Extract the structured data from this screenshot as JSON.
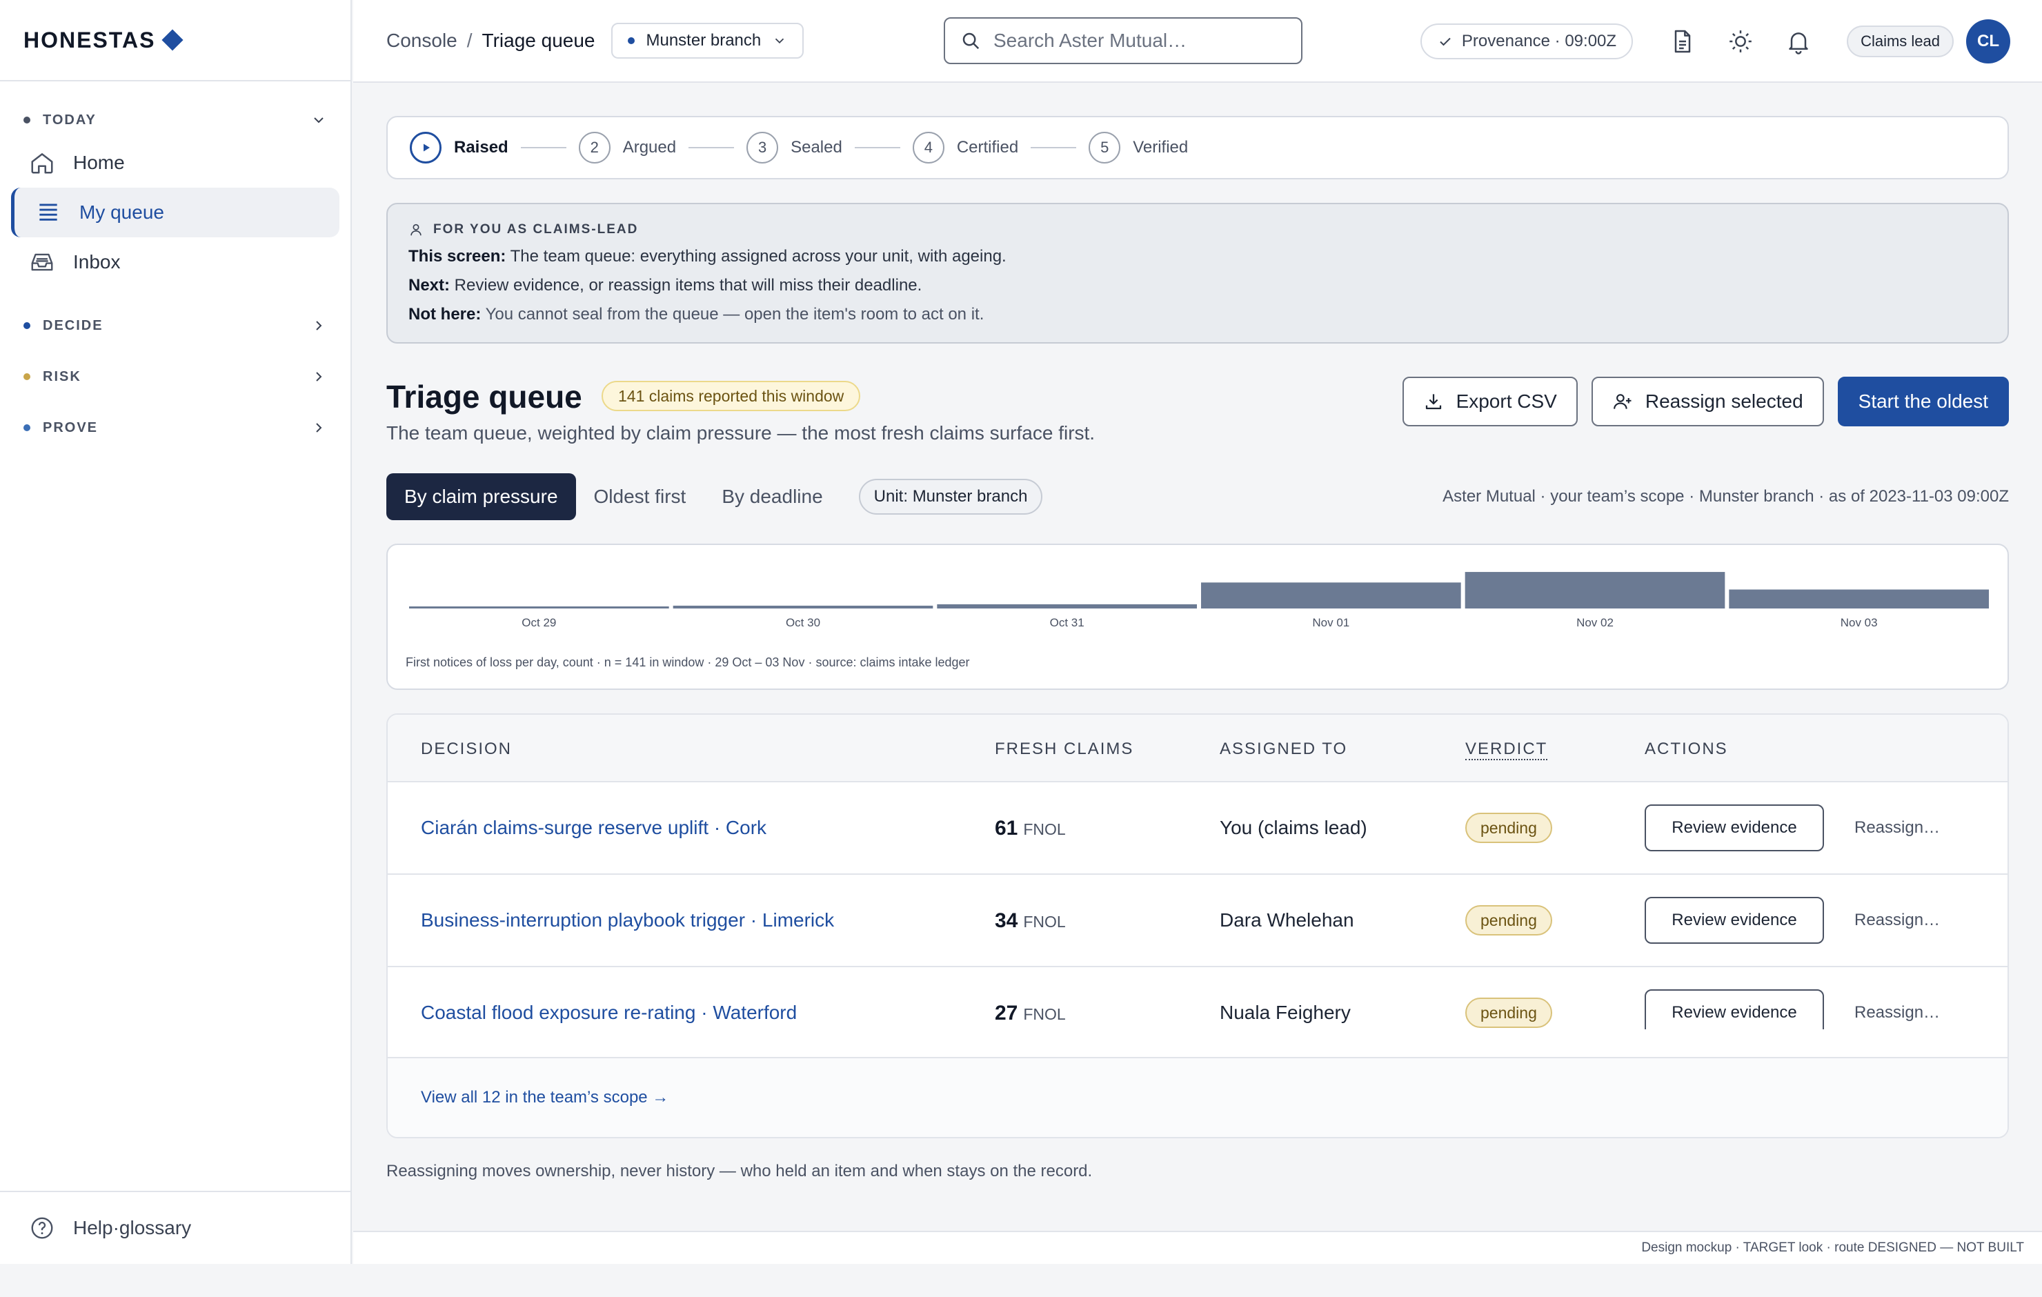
{
  "brand": {
    "name": "HONESTAS"
  },
  "sidebar": {
    "sections": [
      {
        "label": "TODAY",
        "dot_color": "#4a5263",
        "expanded": true
      },
      {
        "label": "DECIDE",
        "dot_color": "#1f4ea0",
        "expanded": false
      },
      {
        "label": "RISK",
        "dot_color": "#c9a54a",
        "expanded": false
      },
      {
        "label": "PROVE",
        "dot_color": "#3b6fb6",
        "expanded": false
      }
    ],
    "items": [
      {
        "label": "Home",
        "icon": "home-icon"
      },
      {
        "label": "My queue",
        "icon": "queue-icon",
        "active": true
      },
      {
        "label": "Inbox",
        "icon": "inbox-icon"
      }
    ],
    "footer": {
      "label": "Help·glossary",
      "icon": "help-icon"
    }
  },
  "topbar": {
    "breadcrumb": {
      "root": "Console",
      "separator": "/",
      "current": "Triage queue"
    },
    "branch": "Munster branch",
    "search_placeholder": "Search Aster Mutual…",
    "provenance": "Provenance · 09:00Z",
    "role": "Claims lead",
    "avatar": "CL"
  },
  "stepper": {
    "steps": [
      {
        "marker": "",
        "label": "Raised",
        "active": true
      },
      {
        "marker": "2",
        "label": "Argued"
      },
      {
        "marker": "3",
        "label": "Sealed"
      },
      {
        "marker": "4",
        "label": "Certified"
      },
      {
        "marker": "5",
        "label": "Verified"
      }
    ]
  },
  "info": {
    "heading": "FOR YOU AS CLAIMS-LEAD",
    "lines": [
      {
        "key": "This screen:",
        "text": " The team queue: everything assigned across your unit, with ageing."
      },
      {
        "key": "Next:",
        "text": " Review evidence, or reassign items that will miss their deadline."
      },
      {
        "key": "Not here:",
        "text": " You cannot seal from the queue — open the item's room to act on it."
      }
    ]
  },
  "page": {
    "title": "Triage queue",
    "badge": "141 claims reported this window",
    "subtitle": "The team queue, weighted by claim pressure — the most fresh claims surface first.",
    "buttons": {
      "export": "Export CSV",
      "reassign": "Reassign selected",
      "start": "Start the oldest"
    }
  },
  "filters": {
    "options": [
      "By claim pressure",
      "Oldest first",
      "By deadline"
    ],
    "active_index": 0,
    "unit_chip": "Unit: Munster branch",
    "scope_note": "Aster Mutual · your team’s scope · Munster branch · as of 2023-11-03 09:00Z"
  },
  "chart_data": {
    "type": "bar",
    "categories": [
      "Oct 29",
      "Oct 30",
      "Oct 31",
      "Nov 01",
      "Nov 02",
      "Nov 03"
    ],
    "values": [
      2,
      4,
      6,
      37,
      52,
      27
    ],
    "ylim": [
      0,
      55
    ],
    "bar_color": "#6b7a93",
    "grid": false,
    "caption": "First notices of loss per day, count · n = 141 in window · 29 Oct – 03 Nov · source: claims intake ledger"
  },
  "table": {
    "columns": [
      "DECISION",
      "FRESH CLAIMS",
      "ASSIGNED TO",
      "VERDICT",
      "ACTIONS"
    ],
    "rows": [
      {
        "decision": "Ciarán claims-surge reserve uplift · Cork",
        "claims": "61",
        "unit": "FNOL",
        "assignee": "You (claims lead)",
        "verdict": "pending",
        "action": "Review evidence",
        "secondary": "Reassign…"
      },
      {
        "decision": "Business-interruption playbook trigger · Limerick",
        "claims": "34",
        "unit": "FNOL",
        "assignee": "Dara Whelehan",
        "verdict": "pending",
        "action": "Review evidence",
        "secondary": "Reassign…"
      },
      {
        "decision": "Coastal flood exposure re-rating · Waterford",
        "claims": "27",
        "unit": "FNOL",
        "assignee": "Nuala Feighery",
        "verdict": "pending",
        "action": "Review evidence",
        "secondary": "Reassign…"
      }
    ],
    "view_all": "View all 12 in the team’s scope →"
  },
  "bottom_note": "Reassigning moves ownership, never history — who held an item and when stays on the record.",
  "footer_note": "Design mockup · TARGET look · route DESIGNED — NOT BUILT"
}
